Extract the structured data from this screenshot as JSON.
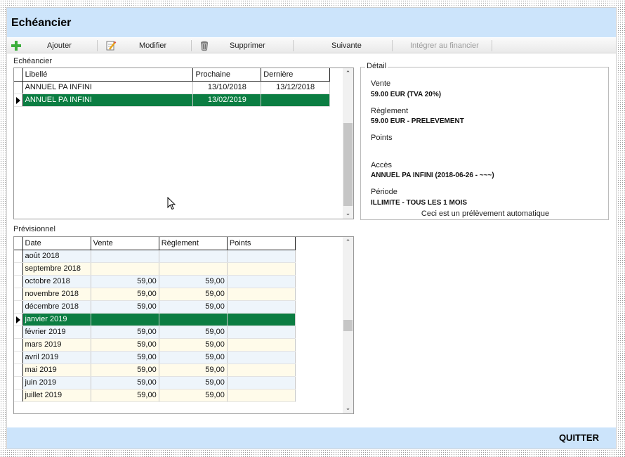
{
  "window": {
    "title": "Echéancier"
  },
  "toolbar": {
    "add_label": "Ajouter",
    "edit_label": "Modifier",
    "delete_label": "Supprimer",
    "next_label": "Suivante",
    "integrate_label": "Intégrer au financier"
  },
  "echeancier": {
    "section_label": "Echéancier",
    "columns": [
      "Libellé",
      "Prochaine",
      "Dernière"
    ],
    "rows": [
      {
        "libelle": "ANNUEL PA INFINI",
        "prochaine": "13/10/2018",
        "derniere": "13/12/2018"
      },
      {
        "libelle": "ANNUEL PA INFINI",
        "prochaine": "13/02/2019",
        "derniere": ""
      }
    ],
    "selected_index": 1
  },
  "detail": {
    "legend": "Détail",
    "vente_label": "Vente",
    "vente_value": "59.00 EUR (TVA 20%)",
    "reglement_label": "Règlement",
    "reglement_value": "59.00 EUR - PRELEVEMENT",
    "points_label": "Points",
    "points_value": "",
    "acces_label": "Accès",
    "acces_value": "ANNUEL PA INFINI (2018-06-26 - ~~~)",
    "periode_label": "Période",
    "periode_value": "ILLIMITE - TOUS LES 1 MOIS",
    "note": "Ceci est un prélèvement automatique"
  },
  "previsionnel": {
    "section_label": "Prévisionnel",
    "columns": [
      "Date",
      "Vente",
      "Règlement",
      "Points"
    ],
    "rows": [
      {
        "date": "août 2018",
        "vente": "",
        "reglement": "",
        "points": ""
      },
      {
        "date": "septembre 2018",
        "vente": "",
        "reglement": "",
        "points": ""
      },
      {
        "date": "octobre 2018",
        "vente": "59,00",
        "reglement": "59,00",
        "points": ""
      },
      {
        "date": "novembre 2018",
        "vente": "59,00",
        "reglement": "59,00",
        "points": ""
      },
      {
        "date": "décembre 2018",
        "vente": "59,00",
        "reglement": "59,00",
        "points": ""
      },
      {
        "date": "janvier 2019",
        "vente": "",
        "reglement": "",
        "points": ""
      },
      {
        "date": "février 2019",
        "vente": "59,00",
        "reglement": "59,00",
        "points": ""
      },
      {
        "date": "mars 2019",
        "vente": "59,00",
        "reglement": "59,00",
        "points": ""
      },
      {
        "date": "avril 2019",
        "vente": "59,00",
        "reglement": "59,00",
        "points": ""
      },
      {
        "date": "mai 2019",
        "vente": "59,00",
        "reglement": "59,00",
        "points": ""
      },
      {
        "date": "juin 2019",
        "vente": "59,00",
        "reglement": "59,00",
        "points": ""
      },
      {
        "date": "juillet 2019",
        "vente": "59,00",
        "reglement": "59,00",
        "points": ""
      }
    ],
    "selected_index": 5
  },
  "footer": {
    "quit_label": "QUITTER"
  },
  "colors": {
    "title_bar": "#cce4fb",
    "selection": "#0b7d42",
    "add_icon": "#3cae3c"
  },
  "icons": {
    "add": "plus-icon",
    "edit": "pencil-notepad-icon",
    "delete": "trash-bin-icon",
    "row_pointer": "triangle-right-icon",
    "scroll_up": "chevron-up-icon",
    "scroll_down": "chevron-down-icon"
  }
}
